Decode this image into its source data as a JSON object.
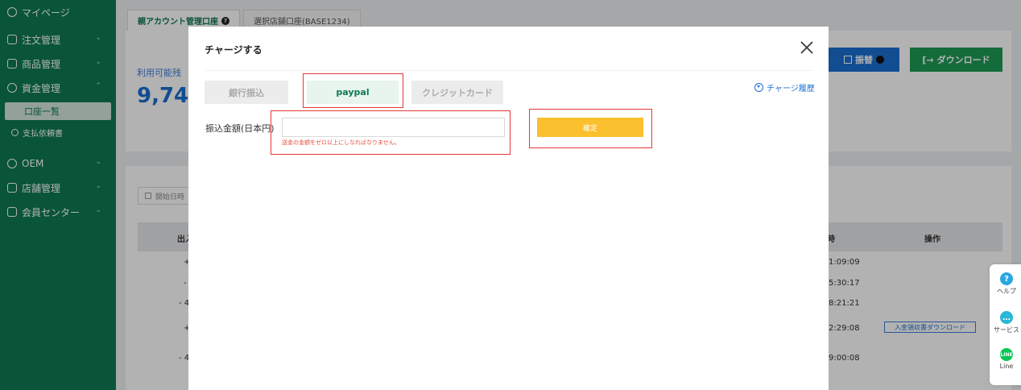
{
  "sidebar": {
    "items": [
      {
        "label": "マイページ"
      },
      {
        "label": "注文管理"
      },
      {
        "label": "商品管理"
      },
      {
        "label": "資金管理"
      },
      {
        "label": "OEM"
      },
      {
        "label": "店舗管理"
      },
      {
        "label": "会員センター"
      }
    ],
    "sub_active": "口座一覧",
    "sub_other": "支払依頼書"
  },
  "background": {
    "tabs": [
      {
        "label": "親アカウント管理口座"
      },
      {
        "label": "選択店舗口座(BASE1234)"
      }
    ],
    "balance_label": "利用可能残",
    "balance_value": "9,74",
    "transfer_button": "振替",
    "download_button": "ダウンロード",
    "date_placeholder": "開始日時",
    "table_headers": {
      "left": "出入",
      "time": "時",
      "actions": "操作"
    },
    "row_signs": [
      "+",
      "-",
      "- 4",
      "+",
      "- 4"
    ],
    "row_times": [
      "1:09:09",
      "5:30:17",
      "8:21:21",
      "2:29:08",
      "9:00:08"
    ],
    "receipt_button": "入金領収書ダウンロード"
  },
  "modal": {
    "title": "チャージする",
    "tabs": [
      {
        "label": "銀行振込",
        "active": false
      },
      {
        "label": "paypal",
        "active": true
      },
      {
        "label": "クレジットカード",
        "active": false
      }
    ],
    "history_link": "チャージ履歴",
    "amount_label": "振込金額(日本円)",
    "amount_value": "",
    "error_text": "送金の金額をゼロ以上にしなればなりません。",
    "confirm_button": "確定"
  },
  "float_widget": {
    "help": "ヘルプ",
    "service": "サービス",
    "line": "Line"
  },
  "colors": {
    "sidebar": "#0f7a52",
    "primary_blue": "#1a6fd1",
    "confirm_yellow": "#fbc02d",
    "highlight_red": "#e53935",
    "error_red": "#e74c3c"
  }
}
